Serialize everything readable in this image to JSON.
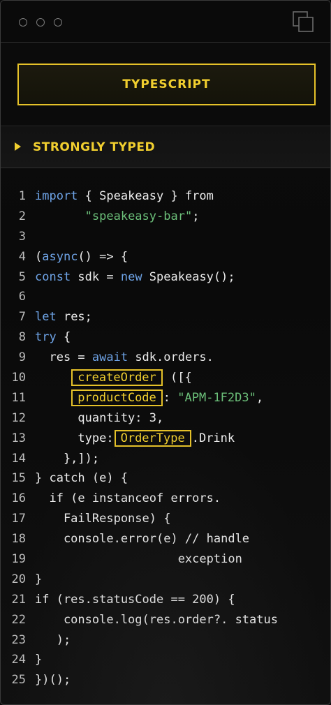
{
  "tab": {
    "label": "TYPESCRIPT"
  },
  "section": {
    "label": "STRONGLY TYPED"
  },
  "code": {
    "lines": [
      {
        "n": "1",
        "parts": [
          {
            "t": "import",
            "c": "kw"
          },
          {
            "t": " { Speakeasy } from"
          }
        ]
      },
      {
        "n": "2",
        "parts": [
          {
            "t": "       "
          },
          {
            "t": "\"speakeasy-bar\"",
            "c": "str"
          },
          {
            "t": ";"
          }
        ]
      },
      {
        "n": "3",
        "parts": []
      },
      {
        "n": "4",
        "parts": [
          {
            "t": "("
          },
          {
            "t": "async",
            "c": "kw"
          },
          {
            "t": "() => {"
          }
        ]
      },
      {
        "n": "5",
        "parts": [
          {
            "t": "const",
            "c": "kw"
          },
          {
            "t": " sdk = "
          },
          {
            "t": "new",
            "c": "kw"
          },
          {
            "t": " Speakeasy();"
          }
        ]
      },
      {
        "n": "6",
        "parts": []
      },
      {
        "n": "7",
        "parts": [
          {
            "t": "let",
            "c": "kw"
          },
          {
            "t": " res;"
          }
        ]
      },
      {
        "n": "8",
        "parts": [
          {
            "t": "try",
            "c": "kw"
          },
          {
            "t": " {"
          }
        ]
      },
      {
        "n": "9",
        "parts": [
          {
            "t": "  res = "
          },
          {
            "t": "await",
            "c": "kw"
          },
          {
            "t": " sdk.orders."
          }
        ]
      },
      {
        "n": "10",
        "parts": [
          {
            "t": "     "
          },
          {
            "t": "createOrder",
            "c": "hl"
          },
          {
            "t": " ([{"
          }
        ]
      },
      {
        "n": "11",
        "parts": [
          {
            "t": "     "
          },
          {
            "t": "productCode",
            "c": "hl"
          },
          {
            "t": ": "
          },
          {
            "t": "\"APM-1F2D3\"",
            "c": "str"
          },
          {
            "t": ","
          }
        ]
      },
      {
        "n": "12",
        "parts": [
          {
            "t": "      quantity: 3,"
          }
        ]
      },
      {
        "n": "13",
        "parts": [
          {
            "t": "      type:"
          },
          {
            "t": "OrderType",
            "c": "hl"
          },
          {
            "t": ".Drink"
          }
        ]
      },
      {
        "n": "14",
        "parts": [
          {
            "t": "    },]);"
          }
        ]
      },
      {
        "n": "15",
        "parts": [
          {
            "t": "} catch (e) {"
          }
        ]
      },
      {
        "n": "16",
        "parts": [
          {
            "t": "  if (e instanceof errors."
          }
        ]
      },
      {
        "n": "17",
        "parts": [
          {
            "t": "    FailResponse) {"
          }
        ]
      },
      {
        "n": "18",
        "parts": [
          {
            "t": "    console.error(e) // handle"
          }
        ]
      },
      {
        "n": "19",
        "parts": [
          {
            "t": "                    exception"
          }
        ]
      },
      {
        "n": "20",
        "parts": [
          {
            "t": "}"
          }
        ]
      },
      {
        "n": "21",
        "parts": [
          {
            "t": "if (res.statusCode == 200) {"
          }
        ]
      },
      {
        "n": "22",
        "parts": [
          {
            "t": "    console.log(res.order?. status"
          }
        ]
      },
      {
        "n": "23",
        "parts": [
          {
            "t": "   );"
          }
        ]
      },
      {
        "n": "24",
        "parts": [
          {
            "t": "}"
          }
        ]
      },
      {
        "n": "25",
        "parts": [
          {
            "t": "})();"
          }
        ]
      }
    ]
  },
  "icons": {
    "window_controls": [
      "dot",
      "dot",
      "dot"
    ],
    "copy": "copy-icon",
    "section": "caret-right-icon"
  },
  "colors": {
    "accent": "#f1cf2f",
    "keyword": "#6ea3e6",
    "string": "#6cc07a",
    "text": "#ececec",
    "background": "#0b0b0b"
  }
}
